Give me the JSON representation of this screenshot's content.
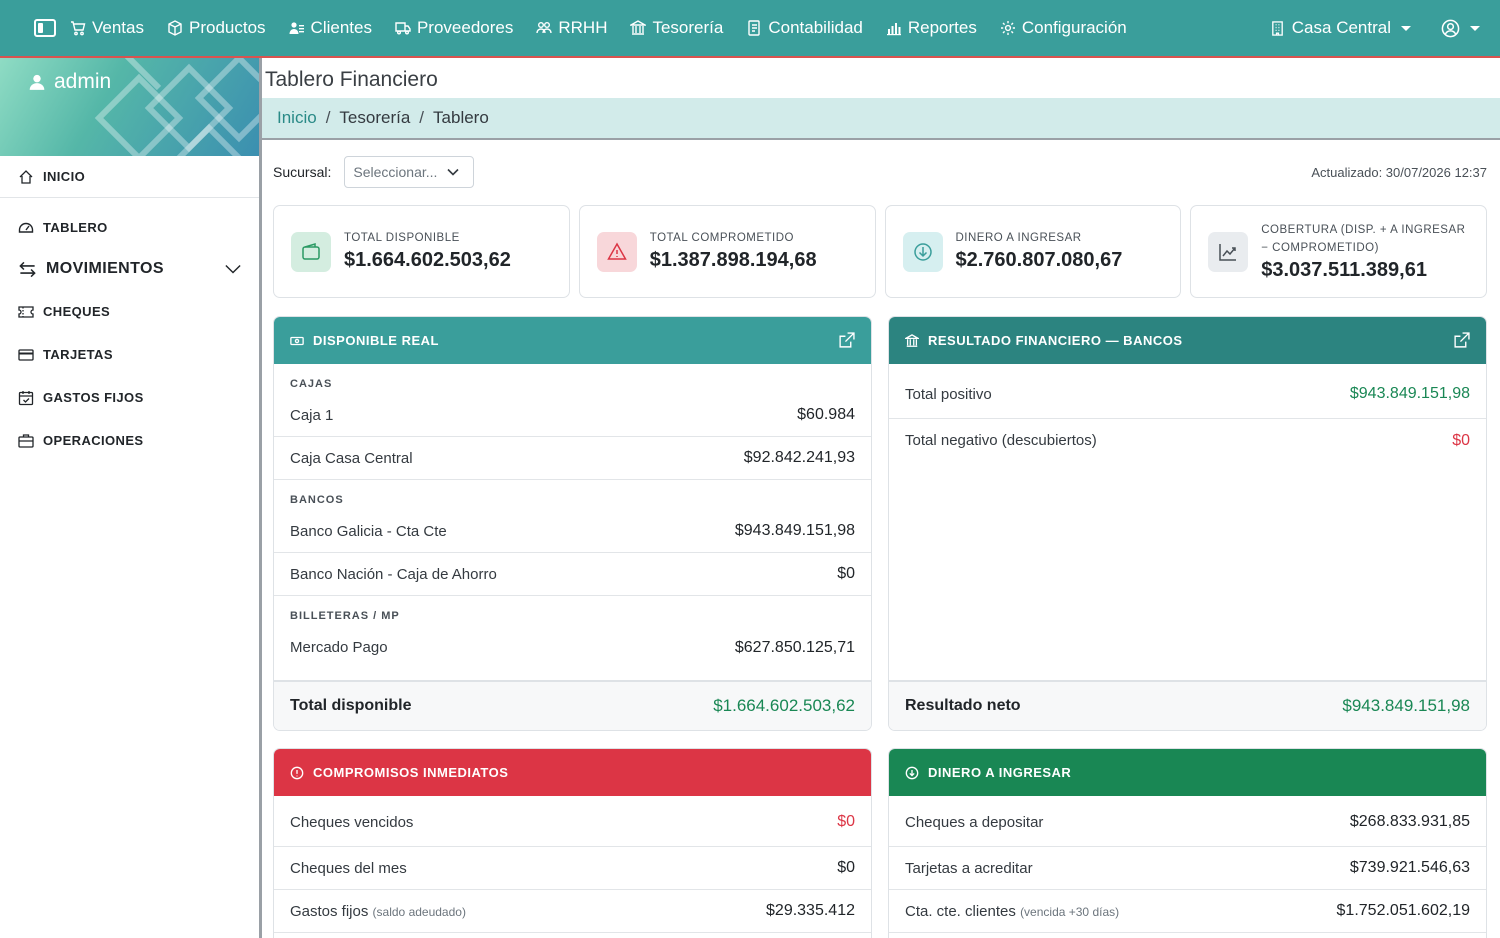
{
  "topbar": {
    "nav": [
      {
        "label": "Ventas",
        "icon": "cart-icon"
      },
      {
        "label": "Productos",
        "icon": "box-icon"
      },
      {
        "label": "Clientes",
        "icon": "people-icon"
      },
      {
        "label": "Proveedores",
        "icon": "truck-icon"
      },
      {
        "label": "RRHH",
        "icon": "people-icon"
      },
      {
        "label": "Tesorería",
        "icon": "bank-icon"
      },
      {
        "label": "Contabilidad",
        "icon": "journal-icon"
      },
      {
        "label": "Reportes",
        "icon": "bar-chart-icon"
      },
      {
        "label": "Configuración",
        "icon": "gear-icon"
      }
    ],
    "branch": "Casa Central"
  },
  "sidebar": {
    "user": "admin",
    "inicio": "INICIO",
    "tablero": "TABLERO",
    "movimientos": "MOVIMIENTOS",
    "sub": [
      "CHEQUES",
      "TARJETAS",
      "GASTOS FIJOS",
      "OPERACIONES"
    ]
  },
  "page": {
    "title": "Tablero Financiero",
    "breadcrumb": [
      "Inicio",
      "Tesorería",
      "Tablero"
    ],
    "sep": "/"
  },
  "filter": {
    "label": "Sucursal:",
    "placeholder": "Seleccionar...",
    "updated": "Actualizado: 30/07/2026 12:37"
  },
  "kpis": [
    {
      "label": "TOTAL DISPONIBLE",
      "value": "$1.664.602.503,62",
      "icon": "wallet-icon"
    },
    {
      "label": "TOTAL COMPROMETIDO",
      "value": "$1.387.898.194,68",
      "icon": "warning-icon"
    },
    {
      "label": "DINERO A INGRESAR",
      "value": "$2.760.807.080,67",
      "icon": "arrow-down-circle-icon"
    },
    {
      "label": "COBERTURA (DISP. + A INGRESAR − COMPROMETIDO)",
      "value": "$3.037.511.389,61",
      "icon": "trend-up-icon"
    }
  ],
  "disponible": {
    "title": "DISPONIBLE REAL",
    "groups": {
      "cajas": "CAJAS",
      "bancos": "BANCOS",
      "billeteras": "BILLETERAS / MP"
    },
    "cajas": [
      {
        "label": "Caja 1",
        "value": "$60.984"
      },
      {
        "label": "Caja Casa Central",
        "value": "$92.842.241,93"
      }
    ],
    "bancos": [
      {
        "label": "Banco Galicia - Cta Cte",
        "value": "$943.849.151,98"
      },
      {
        "label": "Banco Nación - Caja de Ahorro",
        "value": "$0"
      }
    ],
    "billeteras": [
      {
        "label": "Mercado Pago",
        "value": "$627.850.125,71"
      }
    ],
    "total_label": "Total disponible",
    "total_value": "$1.664.602.503,62"
  },
  "resultado": {
    "title": "RESULTADO FINANCIERO — BANCOS",
    "rows": [
      {
        "label": "Total positivo",
        "value": "$943.849.151,98"
      },
      {
        "label": "Total negativo (descubiertos)",
        "value": "$0"
      }
    ],
    "total_label": "Resultado neto",
    "total_value": "$943.849.151,98"
  },
  "compromisos": {
    "title": "COMPROMISOS INMEDIATOS",
    "rows": [
      {
        "label": "Cheques vencidos",
        "value": "$0"
      },
      {
        "label": "Cheques del mes",
        "value": "$0"
      },
      {
        "label": "Gastos fijos",
        "note": "(saldo adeudado)",
        "value": "$29.335.412"
      }
    ]
  },
  "ingresar": {
    "title": "DINERO A INGRESAR",
    "rows": [
      {
        "label": "Cheques a depositar",
        "value": "$268.833.931,85"
      },
      {
        "label": "Tarjetas a acreditar",
        "value": "$739.921.546,63"
      },
      {
        "label": "Cta. cte. clientes",
        "note": "(vencida +30 días)",
        "value": "$1.752.051.602,19"
      }
    ]
  },
  "colors": {
    "primary": "#3a9e9b",
    "primary_dark": "#2c8480",
    "danger": "#dc3545",
    "success": "#198754",
    "breadcrumb_bg": "#d2ebea"
  }
}
